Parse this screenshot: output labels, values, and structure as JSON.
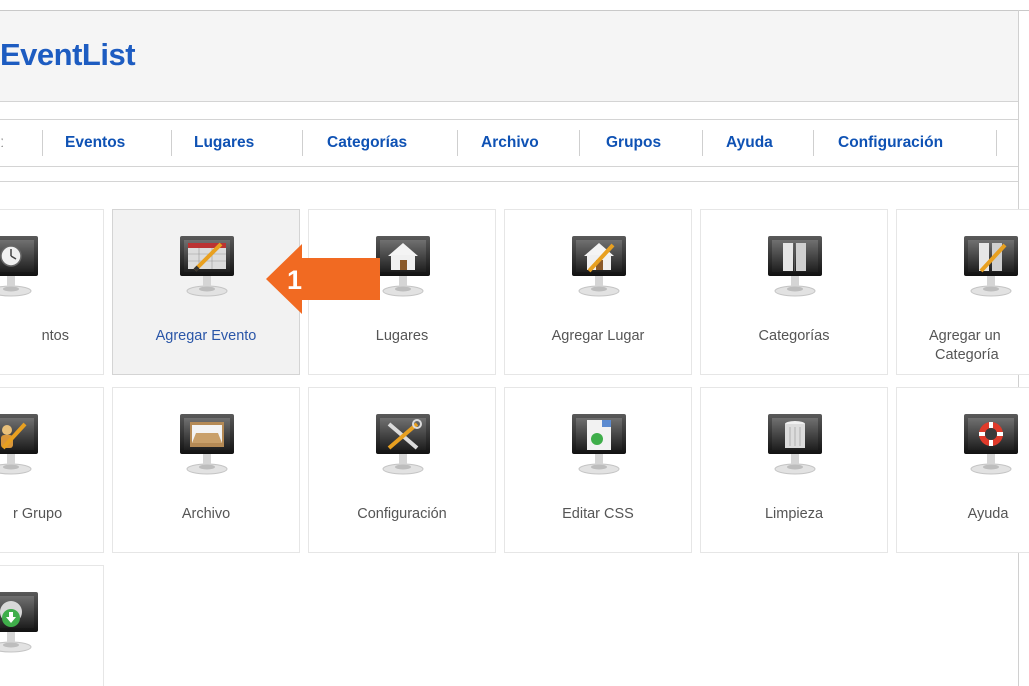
{
  "header": {
    "title": "EventList"
  },
  "menu": {
    "items": [
      "Eventos",
      "Lugares",
      "Categorías",
      "Archivo",
      "Grupos",
      "Ayuda",
      "Configuración"
    ]
  },
  "tiles": [
    {
      "label": "ntos",
      "icon": "event-monitor-icon"
    },
    {
      "label": "Agregar Evento",
      "icon": "add-event-monitor-icon"
    },
    {
      "label": "Lugares",
      "icon": "house-monitor-icon"
    },
    {
      "label": "Agregar Lugar",
      "icon": "add-house-monitor-icon"
    },
    {
      "label": "Categorías",
      "icon": "folder-monitor-icon"
    },
    {
      "label_line1": "Agregar un",
      "label_line2": "Categoría",
      "icon": "add-folder-monitor-icon"
    },
    {
      "label": "r Grupo",
      "icon": "add-group-monitor-icon"
    },
    {
      "label": "Archivo",
      "icon": "archive-monitor-icon"
    },
    {
      "label": "Configuración",
      "icon": "tools-monitor-icon"
    },
    {
      "label": "Editar CSS",
      "icon": "css-monitor-icon"
    },
    {
      "label": "Limpieza",
      "icon": "trash-monitor-icon"
    },
    {
      "label": "Ayuda",
      "icon": "lifebuoy-monitor-icon"
    },
    {
      "label": "",
      "icon": "update-monitor-icon"
    }
  ],
  "callout": {
    "number": "1"
  },
  "colors": {
    "brand": "#1d5cc1",
    "link": "#0f52b4",
    "callout": "#f16a22"
  }
}
